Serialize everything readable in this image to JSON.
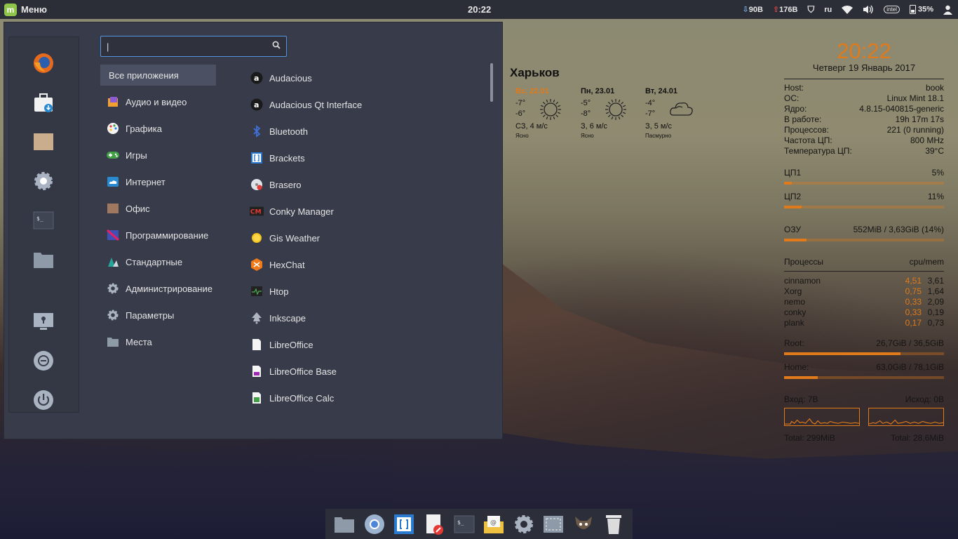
{
  "top_panel": {
    "menu_label": "Меню",
    "clock": "20:22",
    "net_down": "90B",
    "net_up": "176B",
    "keyboard_layout": "ru",
    "cpu_chip_label": "intel",
    "battery": "35%"
  },
  "search": {
    "value": "|",
    "placeholder": ""
  },
  "categories": [
    {
      "label": "Все приложения",
      "icon": "none",
      "active": true
    },
    {
      "label": "Аудио и видео",
      "icon": "audio-video-icon"
    },
    {
      "label": "Графика",
      "icon": "palette-icon"
    },
    {
      "label": "Игры",
      "icon": "gamepad-icon"
    },
    {
      "label": "Интернет",
      "icon": "cloud-icon"
    },
    {
      "label": "Офис",
      "icon": "briefcase-icon"
    },
    {
      "label": "Программирование",
      "icon": "code-icon"
    },
    {
      "label": "Стандартные",
      "icon": "accessories-icon"
    },
    {
      "label": "Администрирование",
      "icon": "gear-icon"
    },
    {
      "label": "Параметры",
      "icon": "gear-icon"
    },
    {
      "label": "Места",
      "icon": "folder-icon"
    }
  ],
  "apps": [
    {
      "label": "Audacious",
      "icon": "audacious-icon"
    },
    {
      "label": "Audacious Qt Interface",
      "icon": "audacious-icon"
    },
    {
      "label": "Bluetooth",
      "icon": "bluetooth-icon"
    },
    {
      "label": "Brackets",
      "icon": "brackets-icon"
    },
    {
      "label": "Brasero",
      "icon": "disc-icon"
    },
    {
      "label": "Conky Manager",
      "icon": "conky-icon"
    },
    {
      "label": "Gis Weather",
      "icon": "sun-icon"
    },
    {
      "label": "HexChat",
      "icon": "hexchat-icon"
    },
    {
      "label": "Htop",
      "icon": "monitor-icon"
    },
    {
      "label": "Inkscape",
      "icon": "inkscape-icon"
    },
    {
      "label": "LibreOffice",
      "icon": "document-icon"
    },
    {
      "label": "LibreOffice Base",
      "icon": "database-icon"
    },
    {
      "label": "LibreOffice Calc",
      "icon": "spreadsheet-icon"
    }
  ],
  "weather": {
    "city": "Харьков",
    "days": [
      {
        "date": "Вс, 22.01",
        "hi": "-7°",
        "lo": "-6°",
        "wind": "СЗ, 4 м/с",
        "cond": "Ясно",
        "icon": "sun-icon"
      },
      {
        "date": "Пн, 23.01",
        "hi": "-5°",
        "lo": "-8°",
        "wind": "З, 6 м/с",
        "cond": "Ясно",
        "icon": "sun-icon"
      },
      {
        "date": "Вт, 24.01",
        "hi": "-4°",
        "lo": "-7°",
        "wind": "З, 5 м/с",
        "cond": "Пасмурно",
        "icon": "cloud-icon"
      }
    ]
  },
  "conky": {
    "time": "20:22",
    "date": "Четверг 19 Январь 2017",
    "sysinfo": [
      {
        "k": "Host:",
        "v": "book"
      },
      {
        "k": "ОС:",
        "v": "Linux Mint 18.1"
      },
      {
        "k": "Ядро:",
        "v": "4.8.15-040815-generic"
      },
      {
        "k": "В работе:",
        "v": "19h 17m 17s"
      },
      {
        "k": "Процессов:",
        "v": "221 (0 running)"
      },
      {
        "k": "Частота ЦП:",
        "v": "800 MHz"
      },
      {
        "k": "Температура ЦП:",
        "v": "39°C"
      }
    ],
    "cpu1": {
      "label": "ЦП1",
      "value": "5%",
      "fraction": 0.05
    },
    "cpu2": {
      "label": "ЦП2",
      "value": "11%",
      "fraction": 0.11
    },
    "ram": {
      "label": "ОЗУ",
      "value": "552MiB / 3,63GiB (14%)",
      "fraction": 0.14
    },
    "proc_header": {
      "k": "Процессы",
      "v": "cpu/mem"
    },
    "processes": [
      {
        "name": "cinnamon",
        "cpu": "4,51",
        "mem": "3,61"
      },
      {
        "name": "Xorg",
        "cpu": "0,75",
        "mem": "1,64"
      },
      {
        "name": "nemo",
        "cpu": "0,33",
        "mem": "2,09"
      },
      {
        "name": "conky",
        "cpu": "0,33",
        "mem": "0,19"
      },
      {
        "name": "plank",
        "cpu": "0,17",
        "mem": "0,73"
      }
    ],
    "root": {
      "label": "Root:",
      "value": "26,7GiB / 36,5GiB",
      "fraction": 0.73
    },
    "home": {
      "label": "Home:",
      "value": "63,0GiB / 78,1GiB",
      "fraction": 0.21
    },
    "net_in": "Вход: 7B",
    "net_out": "Исход: 0B",
    "total_in": "Total: 299MiB",
    "total_out": "Total: 28,6MiB"
  },
  "colors": {
    "accent": "#e07a1a",
    "panel": "#2b2e37",
    "menu_bg": "#383c4a",
    "selection": "#5294e2"
  }
}
